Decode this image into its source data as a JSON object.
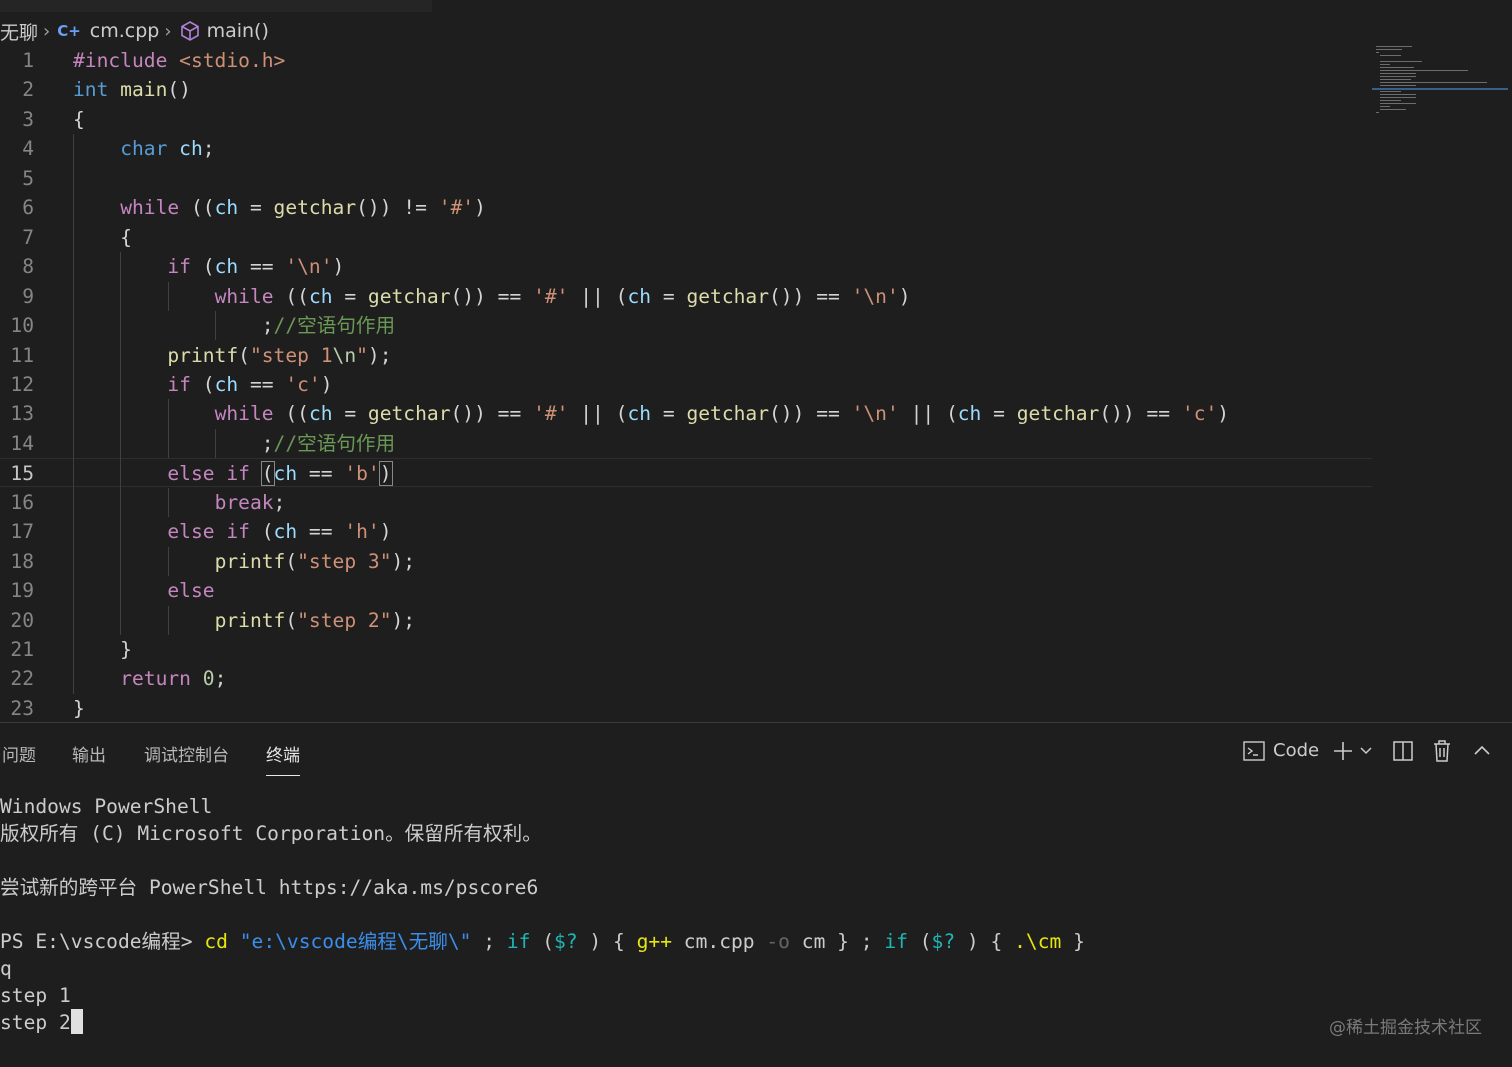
{
  "breadcrumb": {
    "folder": "无聊",
    "file": "cm.cpp",
    "symbol": "main()"
  },
  "editor": {
    "current_line": 15,
    "lines": [
      {
        "num": "1"
      },
      {
        "num": "2"
      },
      {
        "num": "3"
      },
      {
        "num": "4"
      },
      {
        "num": "5"
      },
      {
        "num": "6"
      },
      {
        "num": "7"
      },
      {
        "num": "8"
      },
      {
        "num": "9"
      },
      {
        "num": "10"
      },
      {
        "num": "11"
      },
      {
        "num": "12"
      },
      {
        "num": "13"
      },
      {
        "num": "14"
      },
      {
        "num": "15"
      },
      {
        "num": "16"
      },
      {
        "num": "17"
      },
      {
        "num": "18"
      },
      {
        "num": "19"
      },
      {
        "num": "20"
      },
      {
        "num": "21"
      },
      {
        "num": "22"
      },
      {
        "num": "23"
      }
    ],
    "code": [
      [
        [
          "pp",
          "#include "
        ],
        [
          "inc",
          "<stdio.h>"
        ]
      ],
      [
        [
          "k",
          "int"
        ],
        [
          "",
          ""
        ],
        [
          "f",
          " main"
        ],
        [
          "",
          "()"
        ]
      ],
      [
        [
          "",
          "{"
        ]
      ],
      [
        [
          "",
          "    "
        ],
        [
          "k",
          "char"
        ],
        [
          "v",
          " ch"
        ],
        [
          "",
          ";"
        ]
      ],
      [
        [
          "",
          ""
        ]
      ],
      [
        [
          "",
          "    "
        ],
        [
          "c",
          "while"
        ],
        [
          "",
          " (("
        ],
        [
          "v",
          "ch"
        ],
        [
          "",
          " = "
        ],
        [
          "f",
          "getchar"
        ],
        [
          "",
          "()) != "
        ],
        [
          "s",
          "'#'"
        ],
        [
          "",
          ")"
        ]
      ],
      [
        [
          "",
          "    {"
        ]
      ],
      [
        [
          "",
          "        "
        ],
        [
          "c",
          "if"
        ],
        [
          "",
          " ("
        ],
        [
          "v",
          "ch"
        ],
        [
          "",
          " == "
        ],
        [
          "s",
          "'\\n'"
        ],
        [
          "",
          ")"
        ]
      ],
      [
        [
          "",
          "            "
        ],
        [
          "c",
          "while"
        ],
        [
          "",
          " (("
        ],
        [
          "v",
          "ch"
        ],
        [
          "",
          " = "
        ],
        [
          "f",
          "getchar"
        ],
        [
          "",
          "()) == "
        ],
        [
          "s",
          "'#'"
        ],
        [
          "",
          " || ("
        ],
        [
          "v",
          "ch"
        ],
        [
          "",
          " = "
        ],
        [
          "f",
          "getchar"
        ],
        [
          "",
          "()) == "
        ],
        [
          "s",
          "'\\n'"
        ],
        [
          "",
          ")"
        ]
      ],
      [
        [
          "",
          "                ;"
        ],
        [
          "cm",
          "//空语句作用"
        ]
      ],
      [
        [
          "",
          "        "
        ],
        [
          "f",
          "printf"
        ],
        [
          "",
          "("
        ],
        [
          "s",
          "\"step 1"
        ],
        [
          "n",
          "\\n"
        ],
        [
          "s",
          "\""
        ],
        [
          "",
          ");"
        ]
      ],
      [
        [
          "",
          "        "
        ],
        [
          "c",
          "if"
        ],
        [
          "",
          " ("
        ],
        [
          "v",
          "ch"
        ],
        [
          "",
          " == "
        ],
        [
          "s",
          "'c'"
        ],
        [
          "",
          ")"
        ]
      ],
      [
        [
          "",
          "            "
        ],
        [
          "c",
          "while"
        ],
        [
          "",
          " (("
        ],
        [
          "v",
          "ch"
        ],
        [
          "",
          " = "
        ],
        [
          "f",
          "getchar"
        ],
        [
          "",
          "()) == "
        ],
        [
          "s",
          "'#'"
        ],
        [
          "",
          " || ("
        ],
        [
          "v",
          "ch"
        ],
        [
          "",
          " = "
        ],
        [
          "f",
          "getchar"
        ],
        [
          "",
          "()) == "
        ],
        [
          "s",
          "'\\n'"
        ],
        [
          "",
          " || ("
        ],
        [
          "v",
          "ch"
        ],
        [
          "",
          " = "
        ],
        [
          "f",
          "getchar"
        ],
        [
          "",
          "()) == "
        ],
        [
          "s",
          "'c'"
        ],
        [
          "",
          ")"
        ]
      ],
      [
        [
          "",
          "                ;"
        ],
        [
          "cm",
          "//空语句作用"
        ]
      ],
      [
        [
          "",
          "        "
        ],
        [
          "c",
          "else if"
        ],
        [
          "",
          " "
        ],
        [
          "bm",
          "("
        ],
        [
          "v",
          "ch"
        ],
        [
          "",
          " == "
        ],
        [
          "s",
          "'b'"
        ],
        [
          "bm",
          ")"
        ]
      ],
      [
        [
          "",
          "            "
        ],
        [
          "c",
          "break"
        ],
        [
          "",
          ";"
        ]
      ],
      [
        [
          "",
          "        "
        ],
        [
          "c",
          "else if"
        ],
        [
          "",
          " ("
        ],
        [
          "v",
          "ch"
        ],
        [
          "",
          " == "
        ],
        [
          "s",
          "'h'"
        ],
        [
          "",
          ")"
        ]
      ],
      [
        [
          "",
          "            "
        ],
        [
          "f",
          "printf"
        ],
        [
          "",
          "("
        ],
        [
          "s",
          "\"step 3\""
        ],
        [
          "",
          ");"
        ]
      ],
      [
        [
          "",
          "        "
        ],
        [
          "c",
          "else"
        ]
      ],
      [
        [
          "",
          "            "
        ],
        [
          "f",
          "printf"
        ],
        [
          "",
          "("
        ],
        [
          "s",
          "\"step 2\""
        ],
        [
          "",
          ");"
        ]
      ],
      [
        [
          "",
          "    }"
        ]
      ],
      [
        [
          "",
          "    "
        ],
        [
          "c",
          "return"
        ],
        [
          "",
          " "
        ],
        [
          "n",
          "0"
        ],
        [
          "",
          ";"
        ]
      ],
      [
        [
          "",
          "}"
        ]
      ]
    ]
  },
  "panel": {
    "tabs": [
      {
        "label": "问题",
        "active": false
      },
      {
        "label": "输出",
        "active": false
      },
      {
        "label": "调试控制台",
        "active": false
      },
      {
        "label": "终端",
        "active": true
      }
    ],
    "terminal_name": "Code",
    "icons": [
      "terminal-icon",
      "add-icon",
      "chevron-down-icon",
      "split-icon",
      "trash-icon",
      "chevron-up-icon"
    ]
  },
  "terminal": {
    "lines": [
      [
        [
          "",
          "Windows PowerShell"
        ]
      ],
      [
        [
          "",
          "版权所有 (C) Microsoft Corporation。保留所有权利。"
        ]
      ],
      [
        [
          "",
          ""
        ]
      ],
      [
        [
          "",
          "尝试新的跨平台 PowerShell https://aka.ms/pscore6"
        ]
      ],
      [
        [
          "",
          ""
        ]
      ],
      [
        [
          "",
          "PS E:\\vscode编程> "
        ],
        [
          "y",
          "cd"
        ],
        [
          "",
          " "
        ],
        [
          "s",
          "\"e:\\vscode编程\\无聊\\\""
        ],
        [
          "",
          " ; "
        ],
        [
          "k",
          "if"
        ],
        [
          "",
          " ("
        ],
        [
          "k",
          "$?"
        ],
        [
          "",
          " ) { "
        ],
        [
          "y",
          "g++"
        ],
        [
          "",
          " cm.cpp "
        ],
        [
          "d",
          "-o"
        ],
        [
          "",
          " cm } ; "
        ],
        [
          "k",
          "if"
        ],
        [
          "",
          " ("
        ],
        [
          "k",
          "$?"
        ],
        [
          "",
          " ) { "
        ],
        [
          "y",
          ".\\cm"
        ],
        [
          "",
          " }"
        ]
      ],
      [
        [
          "",
          "q"
        ]
      ],
      [
        [
          "",
          "step 1"
        ]
      ],
      [
        [
          "",
          "step 2"
        ]
      ]
    ]
  },
  "watermark": "@稀土掘金技术社区",
  "colors": {
    "background": "#1e1e1e",
    "keyword": "#569cd6",
    "control": "#c586c0",
    "function": "#dcdcaa",
    "variable": "#9cdcfe",
    "string": "#ce9178",
    "comment": "#6a9955"
  }
}
